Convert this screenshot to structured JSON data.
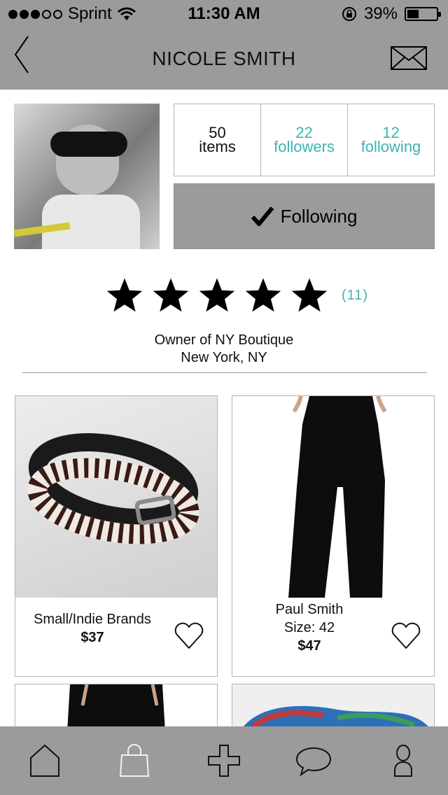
{
  "status": {
    "carrier": "Sprint",
    "signal_bars_filled": 3,
    "signal_bars_total": 5,
    "time": "11:30 AM",
    "battery_pct": "39%",
    "battery_level": 0.39
  },
  "header": {
    "title": "NICOLE SMITH"
  },
  "profile": {
    "stats": [
      {
        "value": "50",
        "label": "items"
      },
      {
        "value": "22",
        "label": "followers"
      },
      {
        "value": "12",
        "label": "following"
      }
    ],
    "follow_button_label": "Following",
    "rating": {
      "stars": 5,
      "count_label": "(11)"
    },
    "bio_line1": "Owner of NY Boutique",
    "bio_line2": "New York, NY"
  },
  "products": [
    {
      "line1": "Small/Indie Brands",
      "line2": "",
      "price": "$37"
    },
    {
      "line1": "Paul Smith",
      "line2": "Size: 42",
      "price": "$47"
    }
  ],
  "colors": {
    "bar_gray": "#9b9b9b",
    "accent_teal": "#3bb5b0"
  },
  "tabbar": {
    "icons": [
      "home-icon",
      "shopping-bag-icon",
      "plus-icon",
      "chat-bubble-icon",
      "person-icon"
    ]
  }
}
